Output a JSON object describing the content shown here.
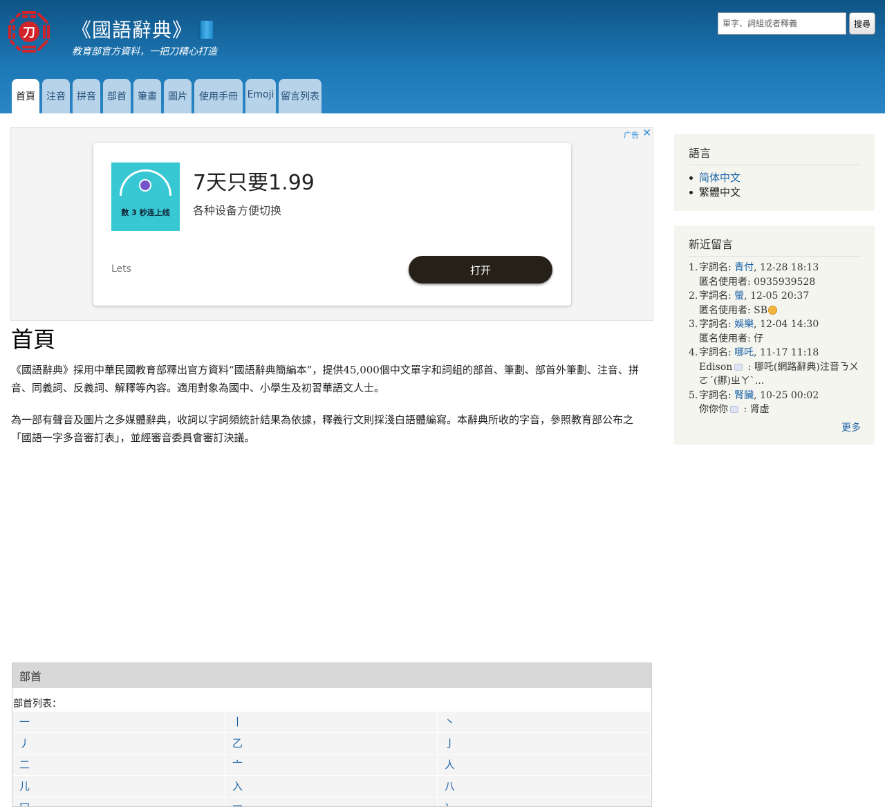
{
  "header": {
    "title": "《國語辭典》",
    "subtitle": "教育部官方資料，一把刀精心打造",
    "search_placeholder": "單字、詞組或者釋義",
    "search_button": "搜尋",
    "logo_text": "刀",
    "title_icon": "book-icon",
    "colors": {
      "header_top": "#0f5486",
      "header_bottom": "#2a86c4",
      "logo_red": "#d0232a"
    }
  },
  "tabs": [
    {
      "label": "首頁",
      "active": true
    },
    {
      "label": "注音"
    },
    {
      "label": "拼音"
    },
    {
      "label": "部首"
    },
    {
      "label": "筆畫"
    },
    {
      "label": "圖片"
    },
    {
      "label": "使用手冊"
    },
    {
      "label": "Emoji"
    },
    {
      "label": "留言列表"
    }
  ],
  "ad": {
    "label": "广告",
    "close": "✕",
    "headline": "7天只要1.99",
    "sub": "各种设备方便切换",
    "brand": "Lets",
    "cta": "打开",
    "image_text": "数 3 秒连上线"
  },
  "main": {
    "title": "首頁",
    "p1": "《國語辭典》採用中華民國教育部釋出官方資料“國語辭典簡編本”，提供45,000個中文單字和詞組的部首、筆劃、部首外筆劃、注音、拼音、同義詞、反義詞、解釋等內容。適用對象為國中、小學生及初習華語文人士。",
    "p2": "為一部有聲音及圖片之多媒體辭典，收詞以字詞頻統計結果為依據，釋義行文則採淺白語體編寫。本辭典所收的字音，參照教育部公布之「國語一字多音審訂表」，並經審音委員會審訂決議。"
  },
  "radicals": {
    "title": "部首",
    "list_label": "部首列表：",
    "items": [
      "一",
      "丨",
      "丶",
      "丿",
      "乙",
      "亅",
      "二",
      "亠",
      "人",
      "儿",
      "入",
      "八",
      "冂",
      "冖",
      "冫"
    ]
  },
  "sidebar": {
    "language": {
      "title": "語言",
      "items": [
        {
          "label": "简体中文",
          "link": true
        },
        {
          "label": "繁體中文",
          "link": false
        }
      ]
    },
    "comments": {
      "title": "新近留言",
      "word_prefix": "字詞名: ",
      "items": [
        {
          "num": "1.",
          "word": "青付",
          "time": ", 12-28 18:13",
          "line2": "匿名使用者: 0935939528",
          "icon": "",
          "line3": ""
        },
        {
          "num": "2.",
          "word": "螢",
          "time": ", 12-05 20:37",
          "line2": "匿名使用者: SB",
          "icon": "emoji",
          "line3": ""
        },
        {
          "num": "3.",
          "word": "娛樂",
          "time": ", 12-04 14:30",
          "line2": "匿名使用者: 仔",
          "icon": "",
          "line3": ""
        },
        {
          "num": "4.",
          "word": "哪吒",
          "time": ", 11-17 11:18",
          "line2": "Edison",
          "icon": "msg",
          "line3": " : 哪吒(網路辭典)注音ㄋㄨㄛˊ(挪)ㄓㄚˋ..."
        },
        {
          "num": "5.",
          "word": "腎臟",
          "time": ", 10-25 00:02",
          "line2": "你你你",
          "icon": "msg",
          "line3": " : 肾虚"
        }
      ],
      "more": "更多"
    }
  }
}
